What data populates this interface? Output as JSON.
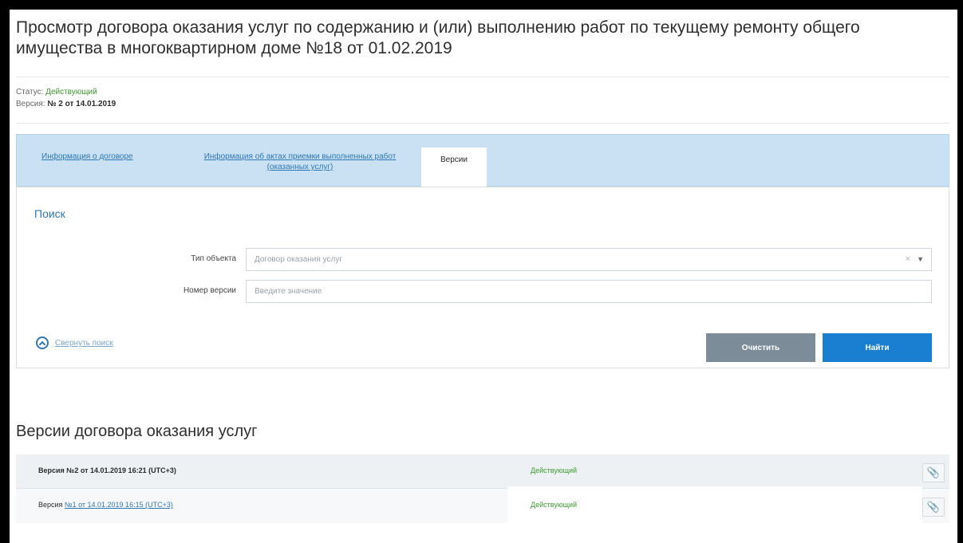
{
  "page": {
    "title": "Просмотр договора оказания услуг по содержанию и (или) выполнению работ по текущему ремонту общего имущества в многоквартирном доме №18 от 01.02.2019"
  },
  "meta": {
    "status_label": "Статус:",
    "status_value": "Действующий",
    "version_label": "Версия:",
    "version_value": "№ 2 от 14.01.2019"
  },
  "tabs": [
    {
      "label": "Информация о договоре"
    },
    {
      "label": "Информация об актах приемки выполненных работ (оказанных услуг)"
    },
    {
      "label": "Версии"
    }
  ],
  "search": {
    "title": "Поиск",
    "object_type": {
      "label": "Тип объекта",
      "value": "Договор оказания услуг"
    },
    "version_number": {
      "label": "Номер версии",
      "placeholder": "Введите значение"
    },
    "collapse_label": "Свернуть поиск",
    "clear_label": "Очистить",
    "find_label": "Найти"
  },
  "versions": {
    "title": "Версии договора оказания услуг",
    "rows": [
      {
        "prefix": "Версия №2 от 14.01.2019 16:21 (UTC+3)",
        "link": "",
        "status": "Действующий"
      },
      {
        "prefix": "Версия ",
        "link": "№1 от 14.01.2019 16:15 (UTC+3)",
        "status": "Действующий"
      }
    ]
  },
  "colors": {
    "accent": "#1a7fd1",
    "tabs_bg": "#c9e1f2",
    "status_green": "#3c9a2e",
    "clear_button": "#7d8c99"
  },
  "icons": {
    "collapse": "chevron-up-circle-icon",
    "attachment": "paperclip-icon",
    "clear": "close-icon",
    "dropdown": "chevron-down-icon"
  }
}
